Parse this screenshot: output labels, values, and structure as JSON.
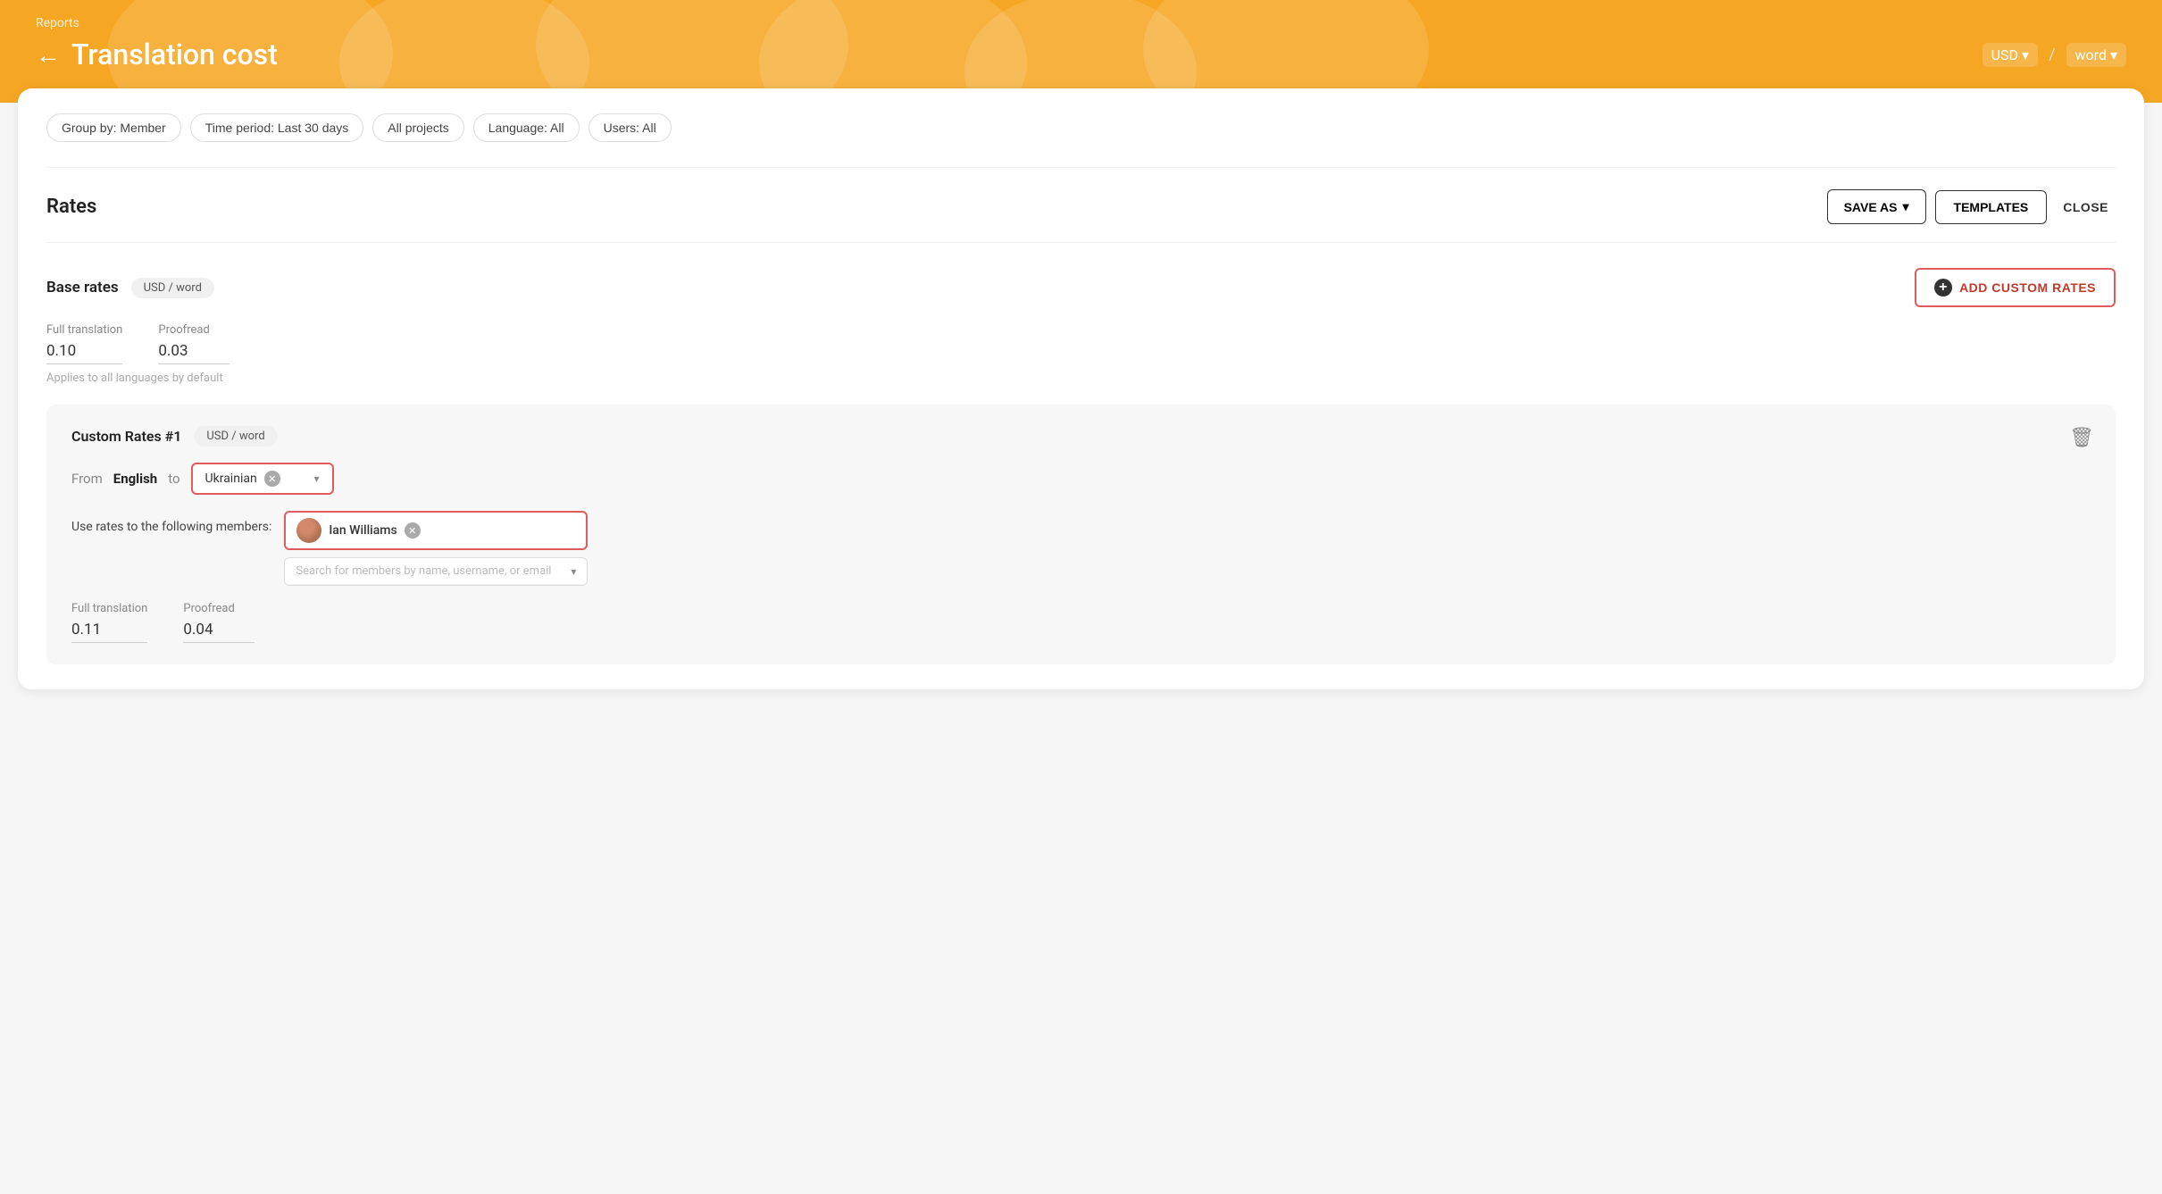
{
  "header": {
    "breadcrumb": "Reports",
    "title": "Translation cost",
    "back_arrow": "←",
    "currency": "USD",
    "separator": "/",
    "unit": "word"
  },
  "filters": [
    {
      "label": "Group by: Member"
    },
    {
      "label": "Time period: Last 30 days"
    },
    {
      "label": "All projects"
    },
    {
      "label": "Language: All"
    },
    {
      "label": "Users: All"
    }
  ],
  "rates_section": {
    "title": "Rates",
    "save_as_label": "SAVE AS",
    "templates_label": "TEMPLATES",
    "close_label": "CLOSE"
  },
  "base_rates": {
    "title": "Base rates",
    "currency_badge": "USD / word",
    "full_translation_label": "Full translation",
    "full_translation_value": "0.10",
    "proofread_label": "Proofread",
    "proofread_value": "0.03",
    "applies_note": "Applies to all languages by default",
    "add_custom_label": "ADD CUSTOM RATES"
  },
  "custom_rates": {
    "title": "Custom Rates #1",
    "currency_badge": "USD / word",
    "from_label": "From",
    "from_lang": "English",
    "to_label": "to",
    "to_lang": "Ukrainian",
    "members_label": "Use rates to the following members:",
    "member_name": "Ian Williams",
    "search_placeholder": "Search for members by name, username, or email",
    "full_translation_label": "Full translation",
    "full_translation_value": "0.11",
    "proofread_label": "Proofread",
    "proofread_value": "0.04",
    "delete_icon": "🗑"
  }
}
